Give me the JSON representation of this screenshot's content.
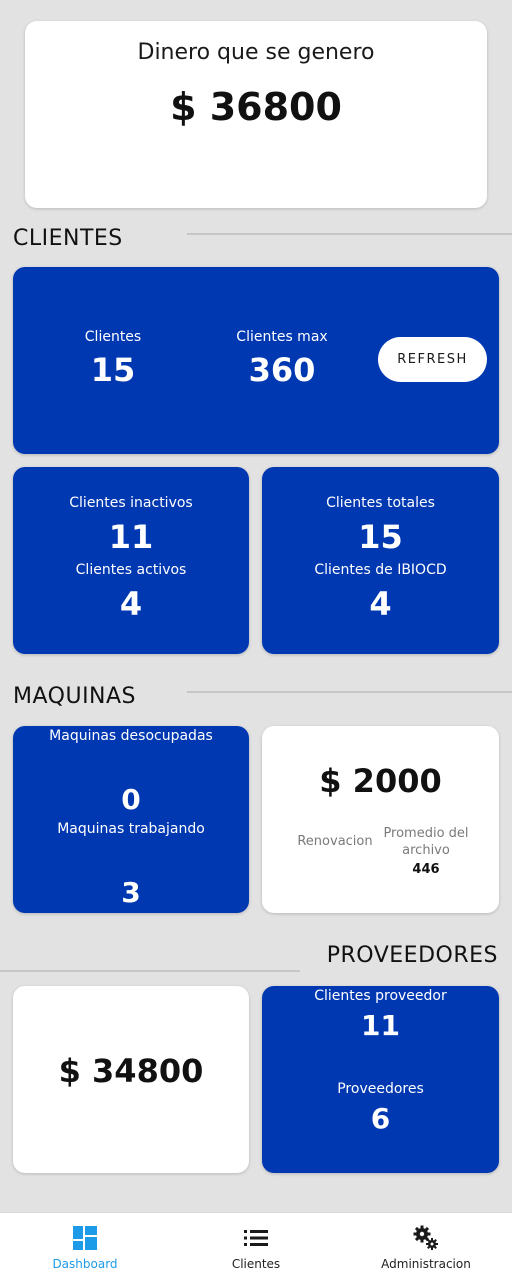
{
  "revenue": {
    "label": "Dinero que se genero",
    "value": "$ 36800"
  },
  "clientes_section": {
    "title": "CLIENTES",
    "clientes_label": "Clientes",
    "clientes_value": "15",
    "clientes_max_label": "Clientes max",
    "clientes_max_value": "360",
    "refresh_label": "REFRESH",
    "inactivos_label": "Clientes inactivos",
    "inactivos_value": "11",
    "activos_label": "Clientes activos",
    "activos_value": "4",
    "totales_label": "Clientes totales",
    "totales_value": "15",
    "ibiocd_label": "Clientes de IBIOCD",
    "ibiocd_value": "4"
  },
  "maquinas_section": {
    "title": "MAQUINAS",
    "desocupadas_label": "Maquinas desocupadas",
    "desocupadas_value": "0",
    "trabajando_label": "Maquinas trabajando",
    "trabajando_value": "3",
    "renovacion_price": "$ 2000",
    "renovacion_label": "Renovacion",
    "promedio_label": "Promedio del archivo",
    "promedio_value": "446"
  },
  "proveedores_section": {
    "title": "PROVEEDORES",
    "amount": "$ 34800",
    "clientes_proveedor_label": "Clientes proveedor",
    "clientes_proveedor_value": "11",
    "proveedores_label": "Proveedores",
    "proveedores_value": "6"
  },
  "nav": {
    "items": [
      {
        "label": "Dashboard",
        "icon": "dashboard-icon",
        "active": true
      },
      {
        "label": "Clientes",
        "icon": "list-icon",
        "active": false
      },
      {
        "label": "Administracion",
        "icon": "gears-icon",
        "active": false
      }
    ]
  },
  "colors": {
    "accent_blue": "#0038b2",
    "active_nav": "#1e9be8",
    "background": "#e2e2e2"
  }
}
